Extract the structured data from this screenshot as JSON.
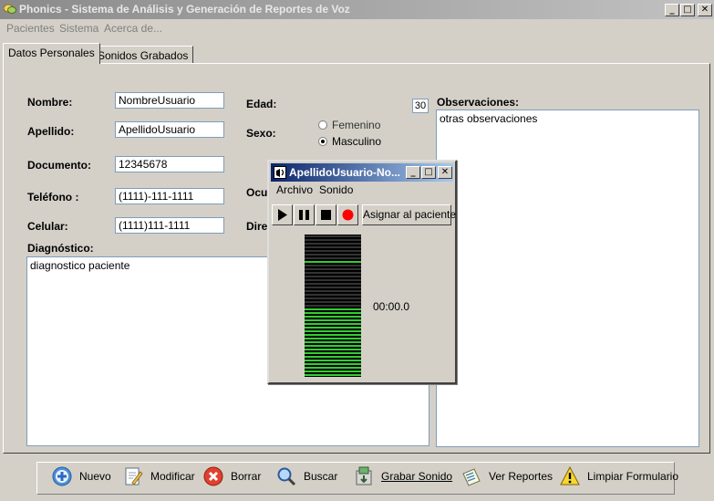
{
  "window": {
    "title": "Phonics - Sistema de Análisis y Generación de Reportes de Voz",
    "controls": {
      "minimize": "_",
      "maximize": "□",
      "close": "✕"
    }
  },
  "menu": {
    "items": [
      {
        "label": "Pacientes"
      },
      {
        "label": "Sistema"
      },
      {
        "label": "Acerca de..."
      }
    ]
  },
  "tabs": [
    {
      "label": "Datos Personales",
      "active": true
    },
    {
      "label": "Sonidos Grabados",
      "active": false
    }
  ],
  "form": {
    "nombre": {
      "label": "Nombre:",
      "value": "NombreUsuario"
    },
    "apellido": {
      "label": "Apellido:",
      "value": "ApellidoUsuario"
    },
    "documento": {
      "label": "Documento:",
      "value": "12345678"
    },
    "telefono": {
      "label": "Teléfono :",
      "value": "(1111)-111-1111"
    },
    "celular": {
      "label": "Celular:",
      "value": "(1111)111-1111"
    },
    "edad": {
      "label": "Edad:",
      "value": "30"
    },
    "sexo": {
      "label": "Sexo:",
      "options": [
        {
          "label": "Femenino",
          "selected": false
        },
        {
          "label": "Masculino",
          "selected": true
        }
      ]
    },
    "ocupacion_partial": "Ocu",
    "direccion_partial": "Dire",
    "diagnostico": {
      "label": "Diagnóstico:",
      "value": "diagnostico paciente"
    },
    "observaciones": {
      "label": "Observaciones:",
      "value": "otras observaciones"
    }
  },
  "recorder": {
    "title": "ApellidoUsuario-No...",
    "menu": [
      {
        "label": "Archivo"
      },
      {
        "label": "Sonido"
      }
    ],
    "controls": {
      "play": "play-icon",
      "pause": "pause-icon",
      "stop": "stop-icon",
      "record": "record-icon"
    },
    "assign_label": "Asignar al paciente",
    "time": "00:00.0",
    "level": 0.48,
    "colors": {
      "meter_on": "#33cc33",
      "meter_off": "#333333",
      "record": "#ff0000",
      "titlebar": "#0a246a"
    }
  },
  "toolbar": {
    "buttons": [
      {
        "label": "Nuevo",
        "icon": "plus-circle-icon"
      },
      {
        "label": "Modificar",
        "icon": "edit-document-icon"
      },
      {
        "label": "Borrar",
        "icon": "delete-x-icon"
      },
      {
        "label": "Buscar",
        "icon": "magnifier-icon"
      },
      {
        "label": "Grabar Sonido",
        "icon": "record-sound-icon"
      },
      {
        "label": "Ver Reportes",
        "icon": "report-icon"
      },
      {
        "label": "Limpiar Formulario",
        "icon": "warning-icon"
      }
    ]
  }
}
